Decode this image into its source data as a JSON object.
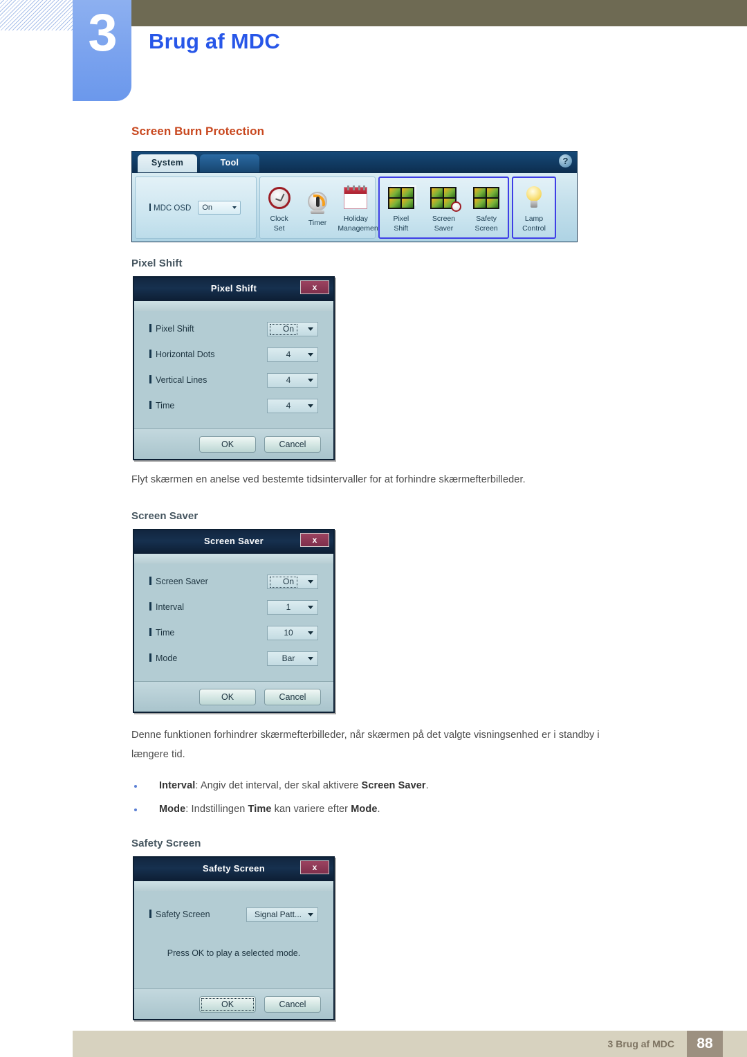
{
  "header": {
    "chapter_number": "3",
    "chapter_title": "Brug af MDC"
  },
  "content": {
    "section_heading": "Screen Burn Protection",
    "sub_heading_pixel_shift": "Pixel Shift",
    "sub_heading_screen_saver": "Screen Saver",
    "sub_heading_safety_screen": "Safety Screen",
    "paragraph_pixel_shift": "Flyt skærmen en anelse ved bestemte tidsintervaller for at forhindre skærmefterbilleder.",
    "paragraph_screen_saver": "Denne funktionen forhindrer skærmefterbilleder, når skærmen på det valgte visningsenhed er i standby i længere tid.",
    "bullets": [
      {
        "term": "Interval",
        "text_before": ": Angiv det interval, der skal aktivere ",
        "emphasis": "Screen Saver",
        "text_after": "."
      },
      {
        "term": "Mode",
        "text_before": ": Indstillingen ",
        "emphasis": "Time",
        "text_mid": " kan variere efter ",
        "emphasis2": "Mode",
        "text_after": "."
      }
    ]
  },
  "mdc_toolbar": {
    "tabs": [
      {
        "label": "System",
        "selected": true
      },
      {
        "label": "Tool",
        "selected": false
      }
    ],
    "help_icon": "?",
    "osd": {
      "label": "MDC OSD",
      "value": "On"
    },
    "schedule_group": [
      {
        "line1": "Clock",
        "line2": "Set",
        "icon": "clock-icon"
      },
      {
        "line1": "Timer",
        "line2": "",
        "icon": "timer-icon"
      },
      {
        "line1": "Holiday",
        "line2": "Management",
        "icon": "calendar-icon"
      }
    ],
    "burn_group": [
      {
        "line1": "Pixel",
        "line2": "Shift",
        "icon": "pixel-shift-icon"
      },
      {
        "line1": "Screen",
        "line2": "Saver",
        "icon": "screen-saver-icon"
      },
      {
        "line1": "Safety",
        "line2": "Screen",
        "icon": "safety-screen-icon"
      }
    ],
    "lamp_group": [
      {
        "line1": "Lamp",
        "line2": "Control",
        "icon": "lamp-icon"
      }
    ],
    "highlight_color": "#3e3ee6"
  },
  "dialog_pixel_shift": {
    "title": "Pixel Shift",
    "close_label": "x",
    "rows": [
      {
        "label": "Pixel Shift",
        "value": "On",
        "focused": true
      },
      {
        "label": "Horizontal Dots",
        "value": "4",
        "focused": false
      },
      {
        "label": "Vertical Lines",
        "value": "4",
        "focused": false
      },
      {
        "label": "Time",
        "value": "4",
        "focused": false
      }
    ],
    "ok_label": "OK",
    "cancel_label": "Cancel"
  },
  "dialog_screen_saver": {
    "title": "Screen Saver",
    "close_label": "x",
    "rows": [
      {
        "label": "Screen Saver",
        "value": "On",
        "focused": true
      },
      {
        "label": "Interval",
        "value": "1",
        "focused": false
      },
      {
        "label": "Time",
        "value": "10",
        "focused": false
      },
      {
        "label": "Mode",
        "value": "Bar",
        "focused": false
      }
    ],
    "ok_label": "OK",
    "cancel_label": "Cancel"
  },
  "dialog_safety_screen": {
    "title": "Safety Screen",
    "close_label": "x",
    "rows": [
      {
        "label": "Safety Screen",
        "value": "Signal Patt...",
        "focused": false
      }
    ],
    "message": "Press OK to play a selected mode.",
    "ok_label": "OK",
    "cancel_label": "Cancel"
  },
  "footer": {
    "text": "3 Brug af MDC",
    "page_number": "88"
  }
}
